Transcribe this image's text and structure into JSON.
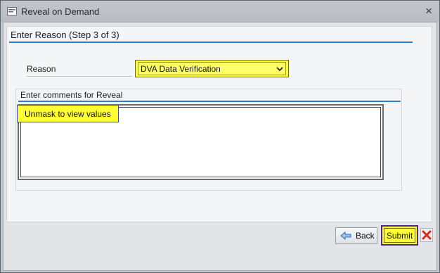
{
  "window": {
    "title": "Reveal on Demand",
    "close_glyph": "×",
    "icons": {
      "title": "dialog-icon",
      "close": "close-icon"
    }
  },
  "step": {
    "heading": "Enter Reason (Step 3 of 3)"
  },
  "reason": {
    "label": "Reason",
    "selected": "DVA Data Verification",
    "chevron_glyph": "⌄"
  },
  "comments": {
    "heading": "Enter comments for Reveal",
    "value": "Unmask to view values"
  },
  "buttons": {
    "back_label": "Back",
    "submit_label": "Submit",
    "cancel_icon": "red-x-icon"
  },
  "colors": {
    "accent_line": "#2d7dc7",
    "highlight": "#ffff33",
    "cancel": "#d9281e"
  }
}
